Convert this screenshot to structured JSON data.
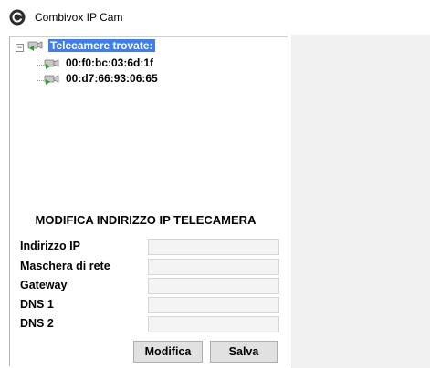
{
  "window": {
    "title": "Combivox IP Cam",
    "icon": "combivox-logo-icon"
  },
  "tree": {
    "root_label": "Telecamere trovate:",
    "items": [
      {
        "label": "00:f0:bc:03:6d:1f",
        "icon": "camera-icon"
      },
      {
        "label": "00:d7:66:93:06:65",
        "icon": "camera-icon"
      }
    ],
    "expander_symbol": "−"
  },
  "form": {
    "heading": "MODIFICA INDIRIZZO IP TELECAMERA",
    "fields": [
      {
        "label": "Indirizzo IP",
        "value": ""
      },
      {
        "label": "Maschera di rete",
        "value": ""
      },
      {
        "label": "Gateway",
        "value": ""
      },
      {
        "label": "DNS 1",
        "value": ""
      },
      {
        "label": "DNS 2",
        "value": ""
      }
    ],
    "buttons": {
      "modify_label": "Modifica",
      "save_label": "Salva"
    }
  },
  "colors": {
    "selection": "#3e7ef0",
    "right_panel": "#f0f0f0",
    "camera_play": "#2aa12a"
  }
}
